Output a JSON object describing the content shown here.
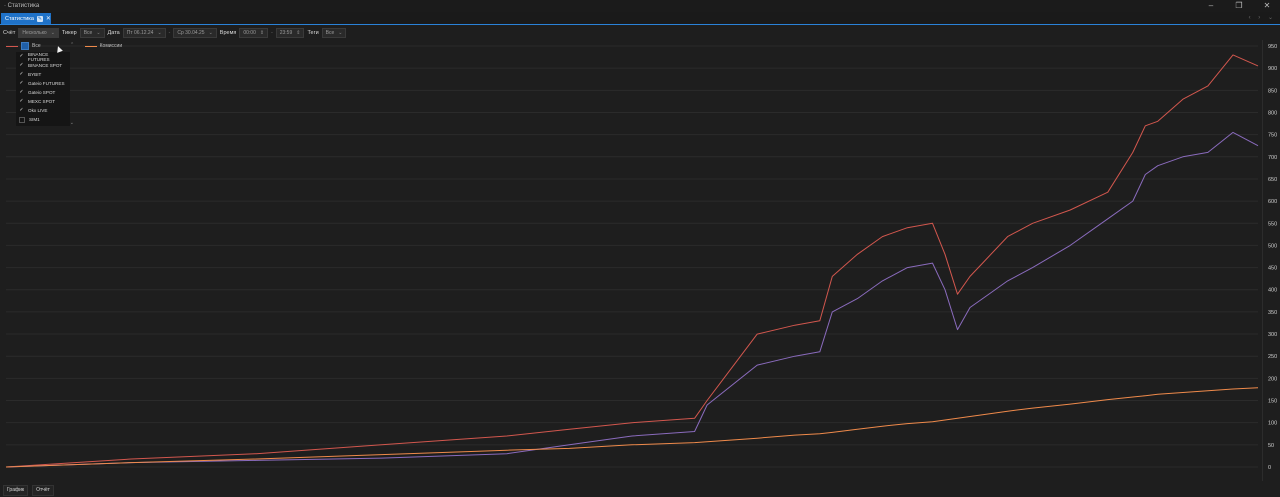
{
  "window": {
    "title": "· Статистика",
    "controls": [
      "minimize",
      "restore",
      "close"
    ]
  },
  "tabs": [
    {
      "label": "Статистика"
    }
  ],
  "toolbar": {
    "account_label": "Счёт",
    "account_value": "Несколько",
    "ticker_label": "Тикер",
    "ticker_value": "Все",
    "date_label": "Дата",
    "date_from": "Пт 06.12.24",
    "date_dash": "-",
    "date_to": "Ср 30.04.25",
    "time_label": "Время",
    "time_from": "00:00",
    "time_dash": "-",
    "time_to": "23:59",
    "tags_label": "Теги",
    "tags_value": "Все"
  },
  "legend": {
    "all_label": "Все",
    "commission_label": "Комиссии"
  },
  "account_dropdown": {
    "items": [
      {
        "label": "BINANCE FUTURES",
        "checked": true
      },
      {
        "label": "BINANCE SPOT",
        "checked": true
      },
      {
        "label": "BYBIT",
        "checked": true
      },
      {
        "label": "Gateio FUTURES",
        "checked": true
      },
      {
        "label": "Gateio SPOT",
        "checked": true
      },
      {
        "label": "MEXC SPOT",
        "checked": true
      },
      {
        "label": "Okx LIVE",
        "checked": true
      },
      {
        "label": "SIM1",
        "checked": false
      }
    ]
  },
  "bottom_tabs": [
    {
      "label": "График"
    },
    {
      "label": "Отчёт"
    }
  ],
  "chart_data": {
    "type": "line",
    "ylim": [
      0,
      950
    ],
    "yticks": [
      "0",
      "50",
      "100",
      "150",
      "200",
      "250",
      "300",
      "350",
      "400",
      "450",
      "500",
      "550",
      "600",
      "650",
      "700",
      "750",
      "800",
      "850",
      "900",
      "950"
    ],
    "grid": true,
    "x": [
      0,
      0.1,
      0.2,
      0.3,
      0.4,
      0.45,
      0.5,
      0.55,
      0.56,
      0.6,
      0.63,
      0.65,
      0.66,
      0.68,
      0.7,
      0.72,
      0.74,
      0.75,
      0.76,
      0.77,
      0.78,
      0.8,
      0.82,
      0.85,
      0.88,
      0.9,
      0.91,
      0.92,
      0.94,
      0.96,
      0.98,
      1.0
    ],
    "series": [
      {
        "color": "#d2574e",
        "values": [
          0,
          18,
          30,
          50,
          70,
          85,
          100,
          110,
          150,
          300,
          320,
          330,
          430,
          480,
          520,
          540,
          550,
          480,
          390,
          430,
          460,
          520,
          550,
          580,
          620,
          710,
          770,
          780,
          830,
          860,
          930,
          905
        ]
      },
      {
        "color": "#8a6bbd",
        "values": [
          0,
          10,
          15,
          20,
          30,
          50,
          70,
          80,
          140,
          230,
          250,
          260,
          350,
          380,
          420,
          450,
          460,
          400,
          310,
          360,
          380,
          420,
          450,
          500,
          560,
          600,
          660,
          680,
          700,
          710,
          755,
          725
        ]
      },
      {
        "color": "#ef8a4b",
        "values": [
          0,
          10,
          18,
          28,
          38,
          42,
          50,
          55,
          57,
          65,
          72,
          75,
          78,
          85,
          92,
          98,
          102,
          106,
          110,
          114,
          118,
          126,
          133,
          142,
          152,
          158,
          161,
          164,
          168,
          172,
          176,
          179
        ]
      }
    ]
  }
}
